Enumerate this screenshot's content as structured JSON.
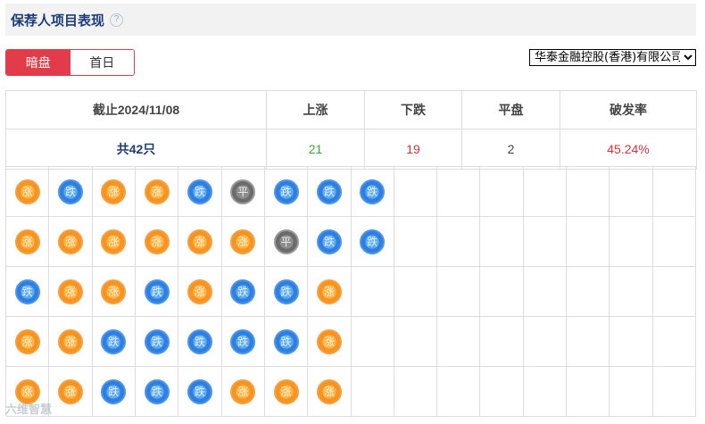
{
  "header": {
    "title": "保荐人项目表现",
    "help_icon": "question-circle-icon"
  },
  "tabs": [
    {
      "label": "暗盘",
      "active": true
    },
    {
      "label": "首日",
      "active": false
    }
  ],
  "broker_select": {
    "selected": "华泰金融控股(香港)有限公司"
  },
  "summary": {
    "headers": [
      "截止2024/11/08",
      "上涨",
      "下跌",
      "平盘",
      "破发率"
    ],
    "total": "共42只",
    "up": "21",
    "down": "19",
    "flat": "2",
    "break_rate": "45.24%"
  },
  "legend_symbols": {
    "rise": "涨",
    "fall": "跌",
    "even": "平"
  },
  "grid": {
    "columns": 16,
    "rows": [
      [
        "rise",
        "fall",
        "rise",
        "rise",
        "fall",
        "even",
        "fall",
        "fall",
        "fall"
      ],
      [
        "rise",
        "rise",
        "rise",
        "rise",
        "rise",
        "rise",
        "even",
        "fall",
        "fall"
      ],
      [
        "fall",
        "rise",
        "rise",
        "fall",
        "rise",
        "fall",
        "fall",
        "rise"
      ],
      [
        "rise",
        "rise",
        "fall",
        "fall",
        "fall",
        "fall",
        "fall",
        "rise"
      ],
      [
        "rise",
        "rise",
        "fall",
        "fall",
        "fall",
        "rise",
        "rise",
        "rise"
      ]
    ]
  },
  "watermark": "六维智慧",
  "colors": {
    "accent_red": "#e23c4a",
    "up_green": "#3aa43c",
    "down_red": "#d2343e",
    "title_blue": "#1c3c78"
  }
}
